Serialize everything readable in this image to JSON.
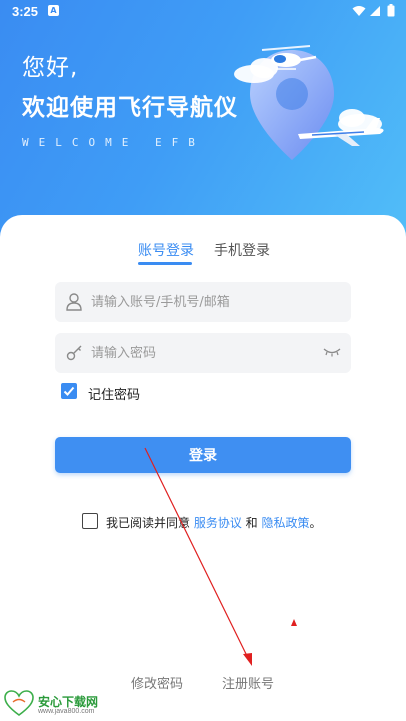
{
  "status_bar": {
    "time": "3:25",
    "notification_badge": "A"
  },
  "hero": {
    "greeting": "您好,",
    "welcome": "欢迎使用飞行导航仪",
    "welcome_en": "WELCOME EFB"
  },
  "tabs": [
    {
      "label": "账号登录",
      "active": true
    },
    {
      "label": "手机登录",
      "active": false
    }
  ],
  "form": {
    "username_placeholder": "请输入账号/手机号/邮箱",
    "username_value": "",
    "password_placeholder": "请输入密码",
    "password_value": "",
    "remember_label": "记住密码",
    "remember_checked": true,
    "login_label": "登录"
  },
  "agreement": {
    "checked": false,
    "prefix": "我已阅读并同意 ",
    "service_link": "服务协议",
    "conjunction": " 和 ",
    "privacy_link": "隐私政策",
    "suffix": "。"
  },
  "bottom_links": {
    "modify_password": "修改密码",
    "register": "注册账号"
  },
  "watermark": {
    "title": "安心下载网",
    "url": "www.java800.com"
  },
  "colors": {
    "accent": "#3a8cf2",
    "hero_start": "#3a8cf2",
    "hero_end": "#52bff8",
    "annotation": "#e02020"
  },
  "icons": [
    "user-icon",
    "key-icon",
    "eye-closed-icon",
    "wifi-icon",
    "signal-icon",
    "battery-icon",
    "checkmark-icon"
  ]
}
